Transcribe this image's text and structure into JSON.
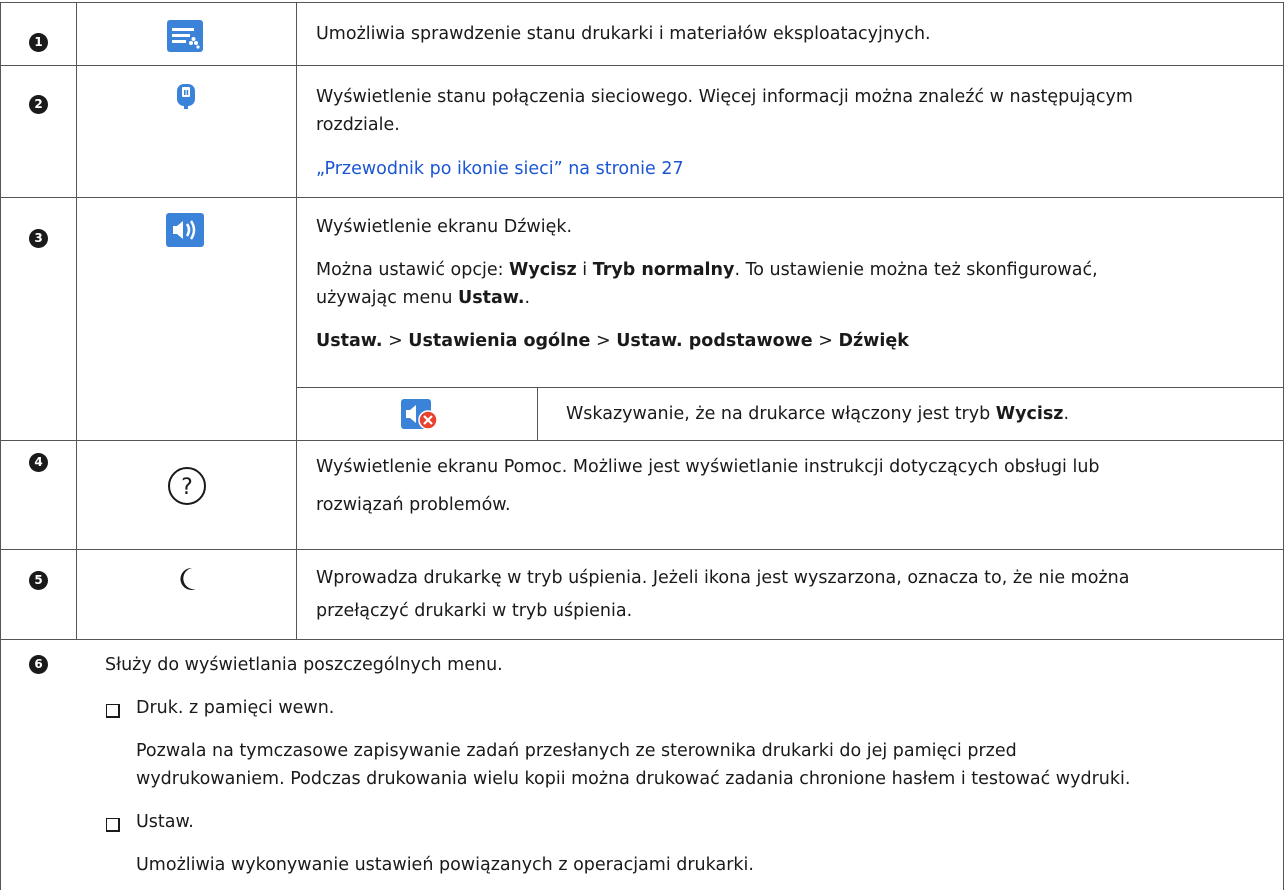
{
  "rows": [
    {
      "num": "1",
      "icon": "printer-status-icon",
      "text": "Umożliwia sprawdzenie stanu drukarki i materiałów eksploatacyjnych."
    },
    {
      "num": "2",
      "icon": "network-status-icon",
      "line1": "Wyświetlenie stanu połączenia sieciowego. Więcej informacji można znaleźć w następującym",
      "line2": "rozdziale.",
      "link": "„Przewodnik po ikonie sieci” na stronie 27"
    },
    {
      "num": "3",
      "icon": "sound-icon",
      "line1": "Wyświetlenie ekranu Dźwięk.",
      "opts_pre": "Można ustawić opcje: ",
      "opt1": "Wycisz",
      "opts_mid": " i ",
      "opt2": "Tryb normalny",
      "opts_post": ". To ustawienie można też skonfigurować,",
      "line3_pre": "używając menu ",
      "line3_bold": "Ustaw.",
      "line3_post": ".",
      "path": [
        "Ustaw.",
        "Ustawienia ogólne",
        "Ustaw. podstawowe",
        "Dźwięk"
      ],
      "path_sep": " > ",
      "sub_icon": "mute-icon",
      "sub_pre": "Wskazywanie, że na drukarce włączony jest tryb ",
      "sub_bold": "Wycisz",
      "sub_post": "."
    },
    {
      "num": "4",
      "icon": "help-icon",
      "line1": "Wyświetlenie ekranu Pomoc. Możliwe jest wyświetlanie instrukcji dotyczących obsługi lub",
      "line2": "rozwiązań problemów."
    },
    {
      "num": "5",
      "icon": "sleep-moon-icon",
      "line1": "Wprowadza drukarkę w tryb uśpienia. Jeżeli ikona jest wyszarzona, oznacza to, że nie można",
      "line2": "przełączyć drukarki w tryb uśpienia."
    },
    {
      "num": "6",
      "line1": "Służy do wyświetlania poszczególnych menu.",
      "item1": "Druk. z pamięci wewn.",
      "item1_desc1": "Pozwala na tymczasowe zapisywanie zadań przesłanych ze sterownika drukarki do jej pamięci przed",
      "item1_desc2": "wydrukowaniem. Podczas drukowania wielu kopii można drukować zadania chronione hasłem i testować wydruki.",
      "item2": "Ustaw.",
      "item2_desc": "Umożliwia wykonywanie ustawień powiązanych z operacjami drukarki."
    }
  ],
  "colors": {
    "border": "#555555",
    "link": "#1a55d6",
    "icon_blue": "#3b82d9",
    "mute_red": "#e8432f"
  }
}
